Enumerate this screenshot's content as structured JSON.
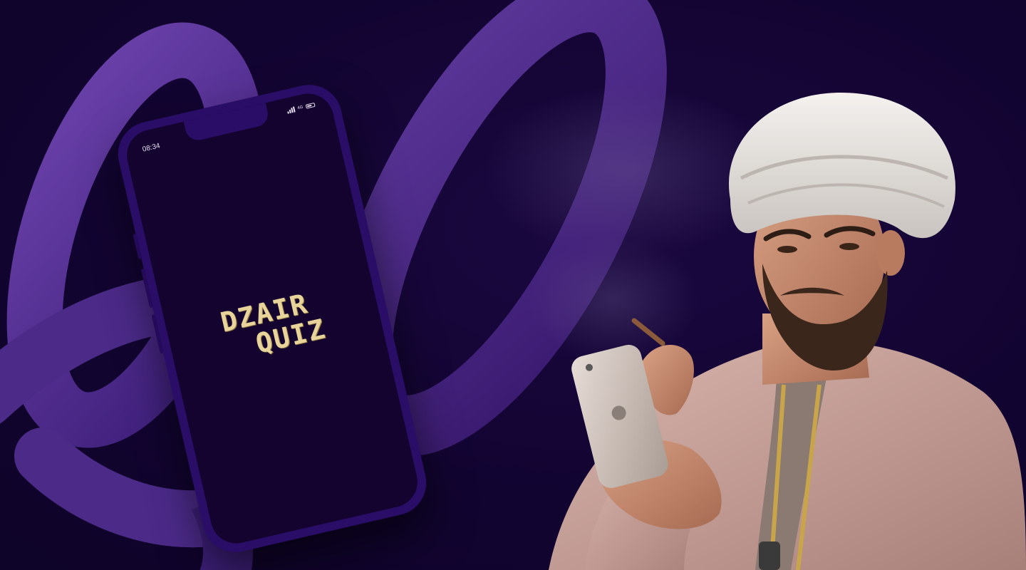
{
  "phone": {
    "status_time": "08:34",
    "network": "4G",
    "logo_line1": "DZAIR",
    "logo_line2": "QUIZ"
  },
  "colors": {
    "background": "#120431",
    "ribbon": "#5b3597",
    "phone_frame": "#2a0d66",
    "screen": "#13032e",
    "logo": "#e8d39a"
  },
  "icons": [
    "signal-icon",
    "battery-icon"
  ]
}
